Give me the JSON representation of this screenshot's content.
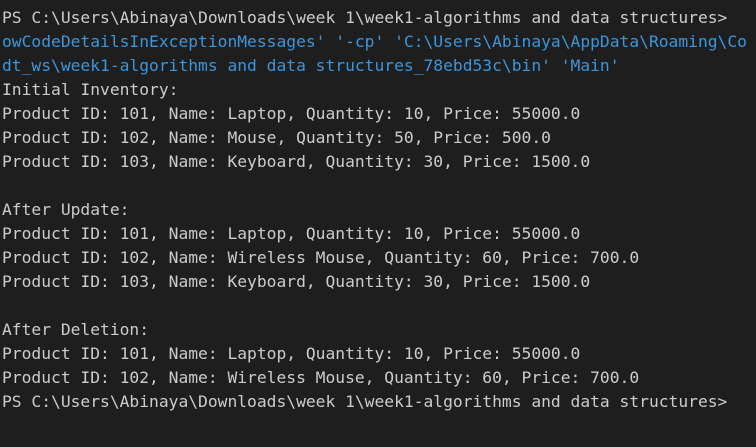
{
  "terminal": {
    "prompt_top": "PS C:\\Users\\Abinaya\\Downloads\\week 1\\week1-algorithms and data structures>",
    "cmd_line_1": "owCodeDetailsInExceptionMessages' '-cp' 'C:\\Users\\Abinaya\\AppData\\Roaming\\Co",
    "cmd_line_2": "dt_ws\\week1-algorithms and data structures_78ebd53c\\bin' 'Main'",
    "sections": [
      {
        "heading": "Initial Inventory:",
        "rows": [
          "Product ID: 101, Name: Laptop, Quantity: 10, Price: 55000.0",
          "Product ID: 102, Name: Mouse, Quantity: 50, Price: 500.0",
          "Product ID: 103, Name: Keyboard, Quantity: 30, Price: 1500.0"
        ]
      },
      {
        "heading": "After Update:",
        "rows": [
          "Product ID: 101, Name: Laptop, Quantity: 10, Price: 55000.0",
          "Product ID: 102, Name: Wireless Mouse, Quantity: 60, Price: 700.0",
          "Product ID: 103, Name: Keyboard, Quantity: 30, Price: 1500.0"
        ]
      },
      {
        "heading": "After Deletion:",
        "rows": [
          "Product ID: 101, Name: Laptop, Quantity: 10, Price: 55000.0",
          "Product ID: 102, Name: Wireless Mouse, Quantity: 60, Price: 700.0"
        ]
      }
    ],
    "prompt_bottom": "PS C:\\Users\\Abinaya\\Downloads\\week 1\\week1-algorithms and data structures>"
  },
  "colors": {
    "background": "#1e1e1e",
    "text": "#cccccc",
    "command_text": "#3a96dd"
  }
}
